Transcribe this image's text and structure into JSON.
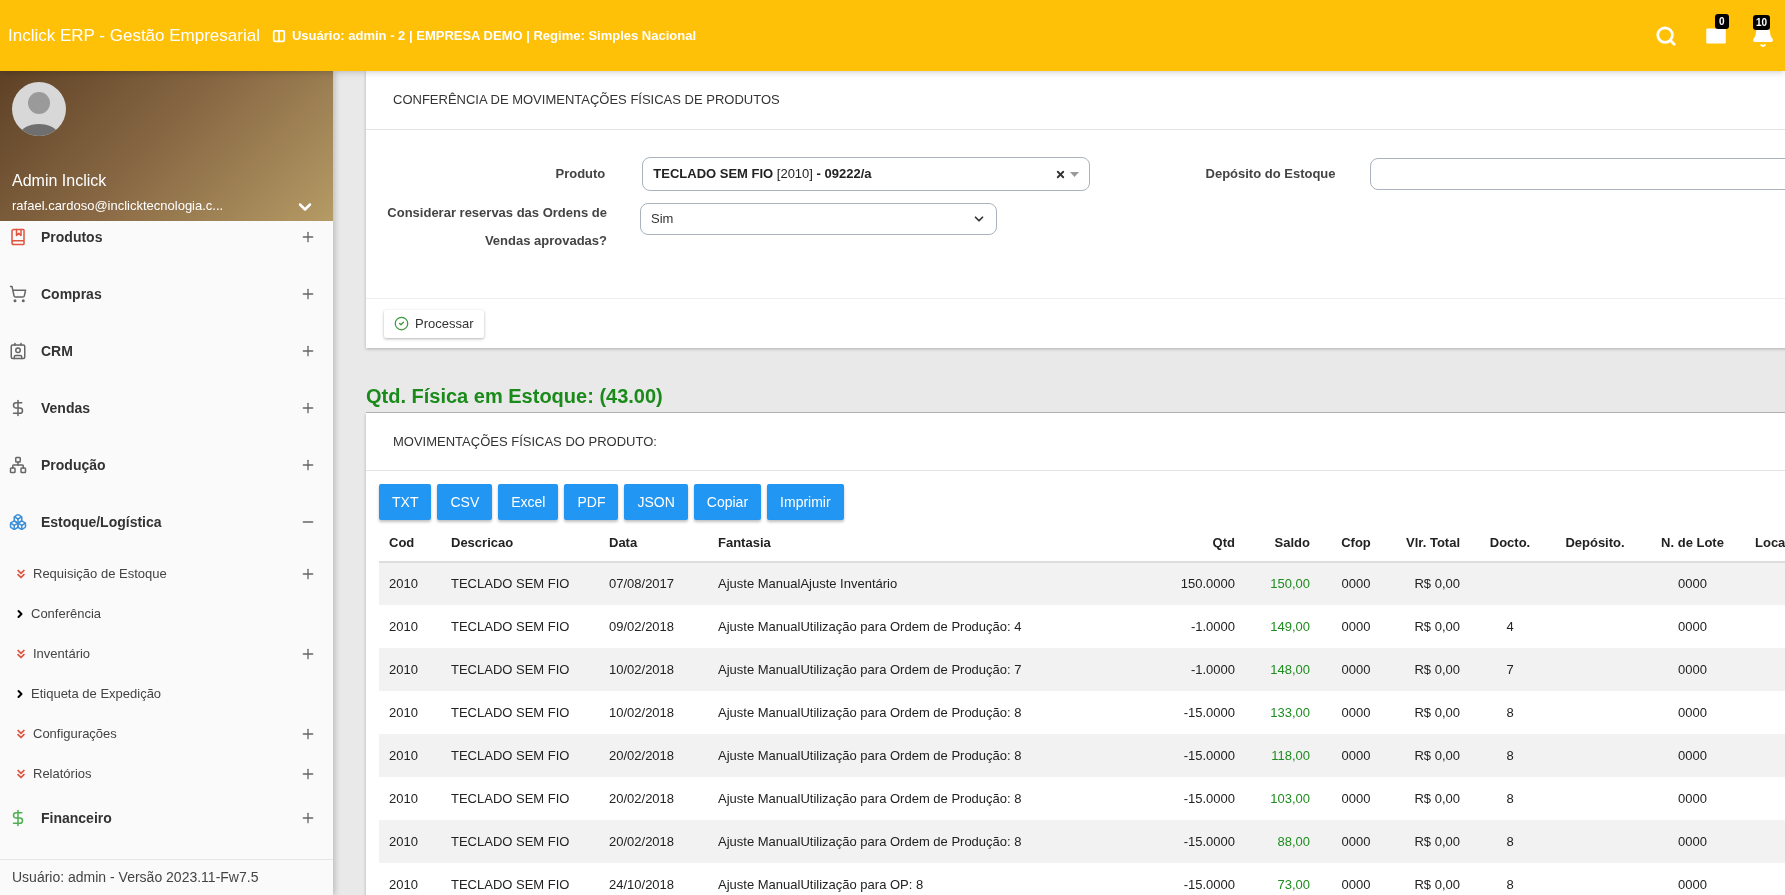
{
  "header": {
    "title": "Inclick ERP - Gestão Empresarial",
    "user_info": "Usuário: admin - 2 | EMPRESA DEMO | Regime: Simples Nacional",
    "mail_count": "0",
    "notification_count": "10"
  },
  "profile": {
    "name": "Admin Inclick",
    "email": "rafael.cardoso@inclicktecnologia.c..."
  },
  "sidebar": {
    "items": [
      {
        "label": "Produtos",
        "expanded": false
      },
      {
        "label": "Compras",
        "expanded": false
      },
      {
        "label": "CRM",
        "expanded": false
      },
      {
        "label": "Vendas",
        "expanded": false
      },
      {
        "label": "Produção",
        "expanded": false
      },
      {
        "label": "Estoque/Logística",
        "expanded": true,
        "children": [
          {
            "label": "Requisição de Estoque",
            "kind": "group"
          },
          {
            "label": "Conferência",
            "kind": "link"
          },
          {
            "label": "Inventário",
            "kind": "group"
          },
          {
            "label": "Etiqueta de Expedição",
            "kind": "link"
          },
          {
            "label": "Configurações",
            "kind": "group"
          },
          {
            "label": "Relatórios",
            "kind": "group"
          }
        ]
      },
      {
        "label": "Financeiro",
        "expanded": false
      }
    ],
    "footer": "Usuário: admin - Versão 2023.11-Fw7.5"
  },
  "filter_card": {
    "title": "CONFERÊNCIA DE MOVIMENTAÇÕES FÍSICAS DE PRODUTOS",
    "product_label": "Produto",
    "product_value": "**TECLADO SEM FIO** [2010] **- 09222/a**",
    "deposit_label": "Depósito do Estoque",
    "reserve_label": "Considerar reservas das Ordens de Vendas aprovadas?",
    "reserve_value": "Sim",
    "process_button": "Processar"
  },
  "stock_heading": "Qtd. Física em Estoque: (43.00)",
  "movements_card": {
    "title": "MOVIMENTAÇÕES FÍSICAS DO PRODUTO:",
    "export_buttons": [
      "TXT",
      "CSV",
      "Excel",
      "PDF",
      "JSON",
      "Copiar",
      "Imprimir"
    ],
    "table": {
      "columns": [
        "Cod",
        "Descricao",
        "Data",
        "Fantasia",
        "Qtd",
        "Saldo",
        "Cfop",
        "Vlr. Total",
        "Docto.",
        "Depósito.",
        "N. de Lote",
        "Loca"
      ],
      "rows": [
        {
          "cod": "2010",
          "descricao": "TECLADO SEM FIO",
          "data": "07/08/2017",
          "fantasia": "Ajuste ManualAjuste Inventário",
          "qtd": "150.0000",
          "saldo": "150,00",
          "cfop": "0000",
          "vlr_total": "R$ 0,00",
          "n_de_lote": "0000"
        },
        {
          "cod": "2010",
          "descricao": "TECLADO SEM FIO",
          "data": "09/02/2018",
          "fantasia": "Ajuste ManualUtilização para Ordem de Produção: 4",
          "qtd": "-1.0000",
          "saldo": "149,00",
          "cfop": "0000",
          "vlr_total": "R$ 0,00",
          "docto": "4",
          "n_de_lote": "0000"
        },
        {
          "cod": "2010",
          "descricao": "TECLADO SEM FIO",
          "data": "10/02/2018",
          "fantasia": "Ajuste ManualUtilização para Ordem de Produção: 7",
          "qtd": "-1.0000",
          "saldo": "148,00",
          "cfop": "0000",
          "vlr_total": "R$ 0,00",
          "docto": "7",
          "n_de_lote": "0000"
        },
        {
          "cod": "2010",
          "descricao": "TECLADO SEM FIO",
          "data": "10/02/2018",
          "fantasia": "Ajuste ManualUtilização para Ordem de Produção: 8",
          "qtd": "-15.0000",
          "saldo": "133,00",
          "cfop": "0000",
          "vlr_total": "R$ 0,00",
          "docto": "8",
          "n_de_lote": "0000"
        },
        {
          "cod": "2010",
          "descricao": "TECLADO SEM FIO",
          "data": "20/02/2018",
          "fantasia": "Ajuste ManualUtilização para Ordem de Produção: 8",
          "qtd": "-15.0000",
          "saldo": "118,00",
          "cfop": "0000",
          "vlr_total": "R$ 0,00",
          "docto": "8",
          "n_de_lote": "0000"
        },
        {
          "cod": "2010",
          "descricao": "TECLADO SEM FIO",
          "data": "20/02/2018",
          "fantasia": "Ajuste ManualUtilização para Ordem de Produção: 8",
          "qtd": "-15.0000",
          "saldo": "103,00",
          "cfop": "0000",
          "vlr_total": "R$ 0,00",
          "docto": "8",
          "n_de_lote": "0000"
        },
        {
          "cod": "2010",
          "descricao": "TECLADO SEM FIO",
          "data": "20/02/2018",
          "fantasia": "Ajuste ManualUtilização para Ordem de Produção: 8",
          "qtd": "-15.0000",
          "saldo": "88,00",
          "cfop": "0000",
          "vlr_total": "R$ 0,00",
          "docto": "8",
          "n_de_lote": "0000"
        },
        {
          "cod": "2010",
          "descricao": "TECLADO SEM FIO",
          "data": "24/10/2018",
          "fantasia": "Ajuste ManualUtilização para OP: 8",
          "qtd": "-15.0000",
          "saldo": "73,00",
          "cfop": "0000",
          "vlr_total": "R$ 0,00",
          "docto": "8",
          "n_de_lote": "0000"
        }
      ]
    }
  }
}
